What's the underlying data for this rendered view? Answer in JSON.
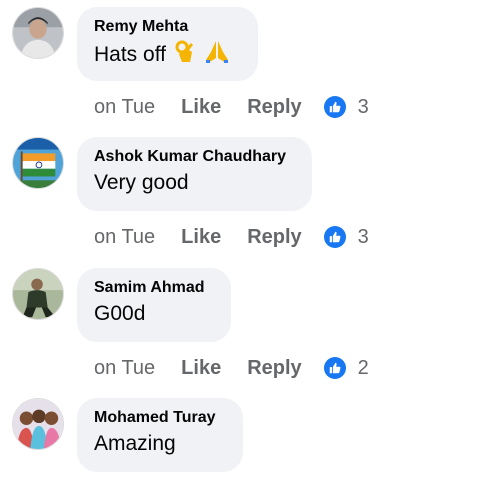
{
  "comments": [
    {
      "author": "Remy Mehta",
      "text": "Hats off",
      "emojis": [
        "ok-hand-emoji",
        "folded-hands-emoji"
      ],
      "time": "on Tue",
      "like_label": "Like",
      "reply_label": "Reply",
      "reaction_count": "3",
      "avatar": "person-photo"
    },
    {
      "author": "Ashok Kumar Chaudhary",
      "text": "Very good",
      "time": "on Tue",
      "like_label": "Like",
      "reply_label": "Reply",
      "reaction_count": "3",
      "avatar": "flag-image"
    },
    {
      "author": "Samim Ahmad",
      "text": "G00d",
      "time": "on Tue",
      "like_label": "Like",
      "reply_label": "Reply",
      "reaction_count": "2",
      "avatar": "person-photo"
    },
    {
      "author": "Mohamed Turay",
      "text": "Amazing",
      "avatar": "group-photo"
    }
  ],
  "colors": {
    "bubble": "#f0f2f5",
    "meta_text": "#65676b",
    "like_badge": "#1877f2"
  }
}
